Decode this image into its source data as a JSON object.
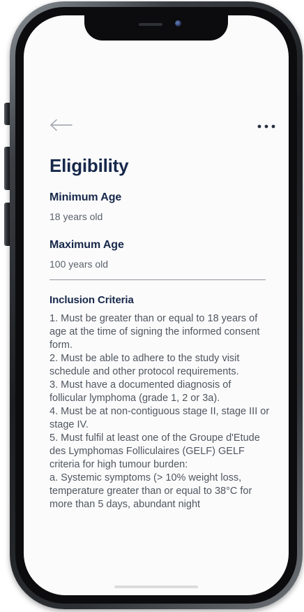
{
  "header": {
    "back_icon": "arrow-left-icon",
    "more_icon": "more-horizontal-icon"
  },
  "page": {
    "title": "Eligibility"
  },
  "minimum_age": {
    "label": "Minimum Age",
    "value": "18 years old"
  },
  "maximum_age": {
    "label": "Maximum Age",
    "value": "100 years old"
  },
  "inclusion": {
    "label": "Inclusion Criteria",
    "text": "1. Must be greater than or equal to 18 years of age at the time of signing the informed consent form.\n2. Must be able to adhere to the study visit schedule and other protocol requirements.\n3. Must have a documented diagnosis of follicular lymphoma (grade 1, 2 or 3a).\n4. Must be at non-contiguous stage II, stage III or stage IV.\n5. Must fulfil at least one of the Groupe d'Etude des Lymphomas Folliculaires (GELF) GELF criteria for high tumour burden:\n a. Systemic symptoms (> 10% weight loss, temperature greater than or equal to 38°C for more than 5 days, abundant night"
  },
  "colors": {
    "heading": "#17284a",
    "body_text": "#50565f",
    "screen_bg": "#fbfbfc"
  }
}
